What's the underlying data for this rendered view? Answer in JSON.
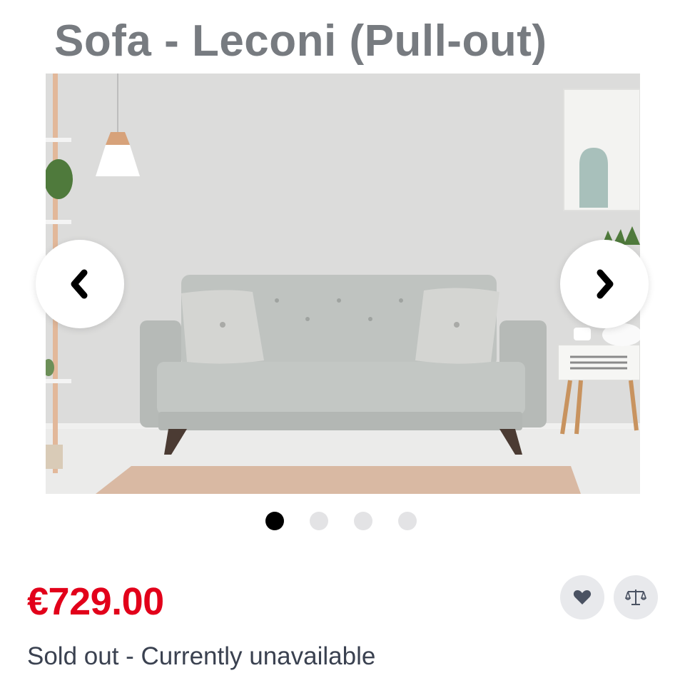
{
  "product": {
    "title": "Sofa - Leconi (Pull-out)",
    "price": "€729.00",
    "availability": "Sold out - Currently unavailable"
  },
  "gallery": {
    "image_count": 4,
    "active_index": 0,
    "prev_icon": "chevron-left-icon",
    "next_icon": "chevron-right-icon"
  },
  "actions": {
    "wishlist_icon": "heart-icon",
    "compare_icon": "scale-icon"
  },
  "colors": {
    "price": "#e2001a",
    "title": "#777b80",
    "text": "#3a4150",
    "dot_active": "#000000",
    "dot_inactive": "#e3e3e5"
  }
}
